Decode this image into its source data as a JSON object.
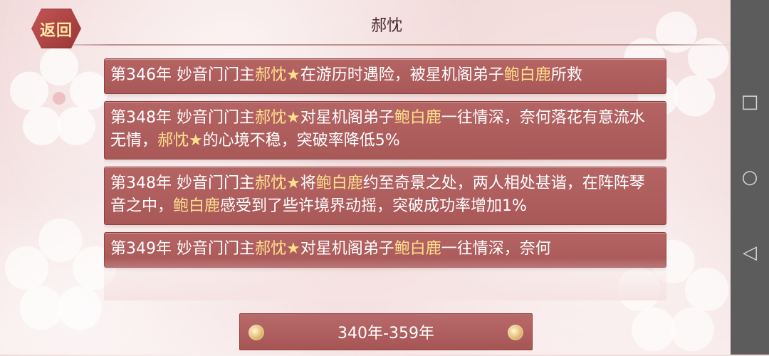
{
  "header": {
    "title": "郝忱",
    "back_label": "返回"
  },
  "entries": [
    {
      "parts": [
        {
          "t": "第346年 妙音门门主",
          "hl": false
        },
        {
          "t": "郝忱★",
          "hl": true
        },
        {
          "t": "在游历时遇险，被星机阁弟子",
          "hl": false
        },
        {
          "t": "鲍白鹿",
          "hl": true
        },
        {
          "t": "所救",
          "hl": false
        }
      ]
    },
    {
      "parts": [
        {
          "t": "第348年 妙音门门主",
          "hl": false
        },
        {
          "t": "郝忱★",
          "hl": true
        },
        {
          "t": "对星机阁弟子",
          "hl": false
        },
        {
          "t": "鲍白鹿",
          "hl": true
        },
        {
          "t": "一往情深，奈何落花有意流水无情，",
          "hl": false
        },
        {
          "t": "郝忱★",
          "hl": true
        },
        {
          "t": "的心境不稳，突破率降低5%",
          "hl": false
        }
      ]
    },
    {
      "parts": [
        {
          "t": "第348年 妙音门门主",
          "hl": false
        },
        {
          "t": "郝忱★",
          "hl": true
        },
        {
          "t": "将",
          "hl": false
        },
        {
          "t": "鲍白鹿",
          "hl": true
        },
        {
          "t": "约至奇景之处，两人相处甚谐，在阵阵琴音之中，",
          "hl": false
        },
        {
          "t": "鲍白鹿",
          "hl": true
        },
        {
          "t": "感受到了些许境界动摇，突破成功率增加1%",
          "hl": false
        }
      ]
    },
    {
      "parts": [
        {
          "t": "第349年 妙音门门主",
          "hl": false
        },
        {
          "t": "郝忱★",
          "hl": true
        },
        {
          "t": "对星机阁弟子",
          "hl": false
        },
        {
          "t": "鲍白鹿",
          "hl": true
        },
        {
          "t": "一往情深，奈何",
          "hl": false
        }
      ]
    }
  ],
  "pager": {
    "range_label": "340年-359年"
  },
  "system_nav": {
    "recent_icon": "square-icon",
    "home_icon": "circle-icon",
    "back_icon": "triangle-back-icon"
  },
  "colors": {
    "accent": "#a95858",
    "highlight": "#ffe08c"
  }
}
